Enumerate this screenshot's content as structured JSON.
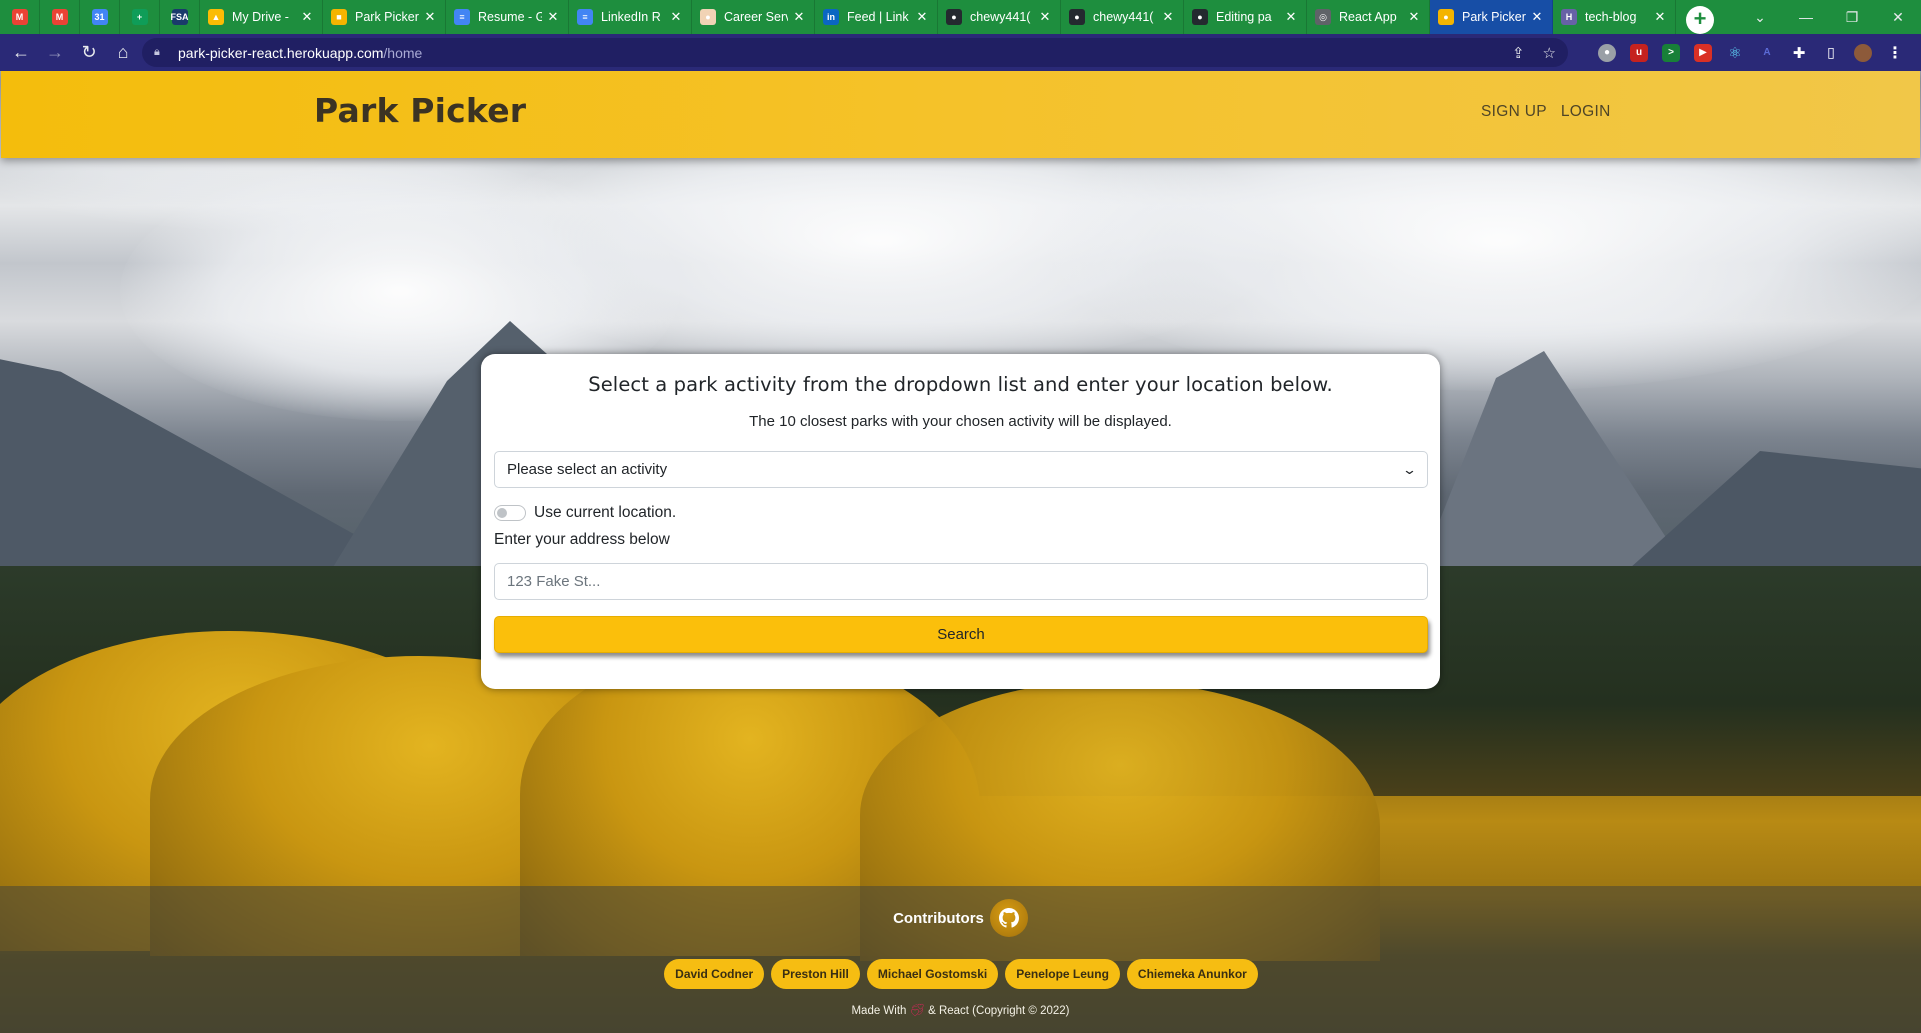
{
  "browser": {
    "tabs": [
      {
        "title": "",
        "icon": "gmail-icon",
        "color": "#ea4335",
        "glyph": "M"
      },
      {
        "title": "",
        "icon": "gmail-icon",
        "color": "#ea4335",
        "glyph": "M"
      },
      {
        "title": "",
        "icon": "calendar-icon",
        "color": "#4285f4",
        "glyph": "31"
      },
      {
        "title": "",
        "icon": "sheets-icon",
        "color": "#0f9d58",
        "glyph": "+"
      },
      {
        "title": "",
        "icon": "fsa-icon",
        "color": "#1a3a6b",
        "glyph": "FSA"
      },
      {
        "title": "My Drive - ",
        "icon": "drive-icon",
        "color": "#fbbc04",
        "glyph": "▲"
      },
      {
        "title": "Park Picker",
        "icon": "slides-icon",
        "color": "#f4b400",
        "glyph": "■"
      },
      {
        "title": "Resume - G",
        "icon": "docs-icon",
        "color": "#4285f4",
        "glyph": "≡"
      },
      {
        "title": "LinkedIn R",
        "icon": "docs-icon",
        "color": "#4285f4",
        "glyph": "≡"
      },
      {
        "title": "Career Serv",
        "icon": "career-icon",
        "color": "#f1d3b5",
        "glyph": "●"
      },
      {
        "title": "Feed | Link",
        "icon": "linkedin-icon",
        "color": "#0a66c2",
        "glyph": "in"
      },
      {
        "title": "chewy441(",
        "icon": "github-icon",
        "color": "#24292f",
        "glyph": "●"
      },
      {
        "title": "chewy441(",
        "icon": "github-icon",
        "color": "#24292f",
        "glyph": "●"
      },
      {
        "title": "Editing pa",
        "icon": "github-icon",
        "color": "#24292f",
        "glyph": "●"
      },
      {
        "title": "React App",
        "icon": "globe-icon",
        "color": "#5f6368",
        "glyph": "◎"
      },
      {
        "title": "Park Picker",
        "icon": "park-picker-icon",
        "color": "#f4b400",
        "glyph": "●",
        "active": true
      },
      {
        "title": "tech-blog",
        "icon": "heroku-icon",
        "color": "#6762a6",
        "glyph": "H"
      }
    ],
    "address": {
      "host": "park-picker-react.herokuapp.com",
      "path": "/home"
    }
  },
  "header": {
    "brand": "Park Picker",
    "nav": {
      "signup": "SIGN UP",
      "login": "LOGIN"
    }
  },
  "search": {
    "heading": "Select a park activity from the dropdown list and enter your location below.",
    "subheading": "The 10 closest parks with your chosen activity will be displayed.",
    "activity_select": "Please select an activity",
    "use_location_label": "Use current location.",
    "use_location_on": false,
    "address_label": "Enter your address below",
    "address_placeholder": "123 Fake St...",
    "address_value": "",
    "button_label": "Search"
  },
  "footer": {
    "contributors_label": "Contributors",
    "contributors": [
      "David Codner",
      "Preston Hill",
      "Michael Gostomski",
      "Penelope Leung",
      "Chiemeka Anunkor"
    ],
    "made_with_prefix": "Made With",
    "made_with_suffix": "& React (Copyright © 2022)"
  },
  "colors": {
    "header": "#f4bd0c",
    "accent": "#fbbf0b",
    "pill": "#f6bd12"
  }
}
